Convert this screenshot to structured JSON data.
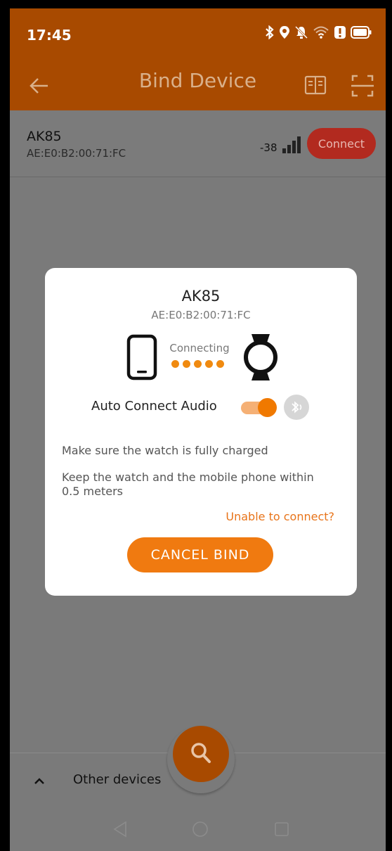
{
  "status_bar": {
    "time": "17:45",
    "icons": [
      "bluetooth-icon",
      "location-icon",
      "mute-icon",
      "wifi-icon",
      "alert-icon",
      "battery-icon"
    ]
  },
  "toolbar": {
    "title": "Bind Device",
    "back_icon": "arrow-left-icon",
    "actions": [
      "book-icon",
      "scan-icon"
    ]
  },
  "device_list": {
    "items": [
      {
        "name": "AK85",
        "mac": "AE:E0:B2:00:71:FC",
        "rssi": "-38",
        "connect_label": "Connect"
      }
    ]
  },
  "dialog": {
    "device_name": "AK85",
    "device_mac": "AE:E0:B2:00:71:FC",
    "status": "Connecting",
    "auto_connect_label": "Auto Connect Audio",
    "auto_connect_enabled": true,
    "tip_charged": "Make sure the watch is fully charged",
    "tip_distance": "Keep the watch and the mobile phone within 0.5 meters",
    "unable_link": "Unable to connect?",
    "cancel_label": "CANCEL BIND"
  },
  "bottom_sheet": {
    "label": "Other devices"
  },
  "colors": {
    "accent": "#f07a10",
    "appbar": "#a84a00",
    "connect": "#b22a1f",
    "link": "#e8741a"
  }
}
